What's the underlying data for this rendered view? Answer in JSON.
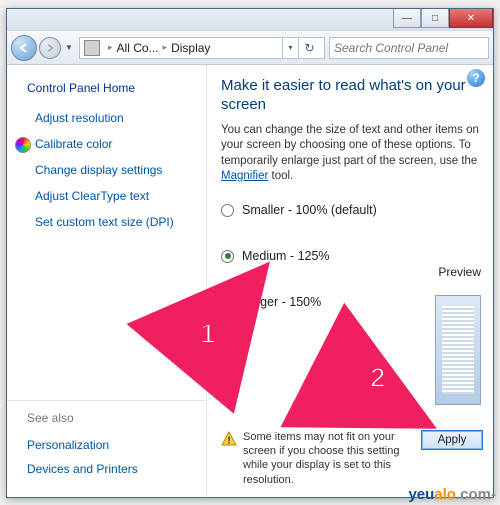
{
  "titlebar": {
    "min": "—",
    "max": "□",
    "close": "✕"
  },
  "nav": {
    "breadcrumb": {
      "l1": "All Co...",
      "l2": "Display"
    },
    "search_placeholder": "Search Control Panel"
  },
  "sidebar": {
    "heading": "Control Panel Home",
    "links": [
      "Adjust resolution",
      "Calibrate color",
      "Change display settings",
      "Adjust ClearType text",
      "Set custom text size (DPI)"
    ],
    "seealso_heading": "See also",
    "seealso": [
      "Personalization",
      "Devices and Printers"
    ]
  },
  "content": {
    "title": "Make it easier to read what's on your screen",
    "desc_a": "You can change the size of text and other items on your screen by choosing one of these options. To temporarily enlarge just part of the screen, use the ",
    "magnifier": "Magnifier",
    "desc_b": " tool.",
    "preview_label": "Preview",
    "options": [
      {
        "label": "Smaller - 100% (default)",
        "value": "smaller",
        "checked": false
      },
      {
        "label": "Medium - 125%",
        "value": "medium",
        "checked": true
      },
      {
        "label": "Larger - 150%",
        "value": "larger",
        "checked": false
      }
    ],
    "warning": "Some items may not fit on your screen if you choose this setting while your display is set to this resolution.",
    "apply": "Apply"
  },
  "annotations": {
    "step1": "1",
    "step2": "2"
  },
  "watermark": {
    "a": "yeu",
    "b": "alo",
    "c": ".com-"
  }
}
